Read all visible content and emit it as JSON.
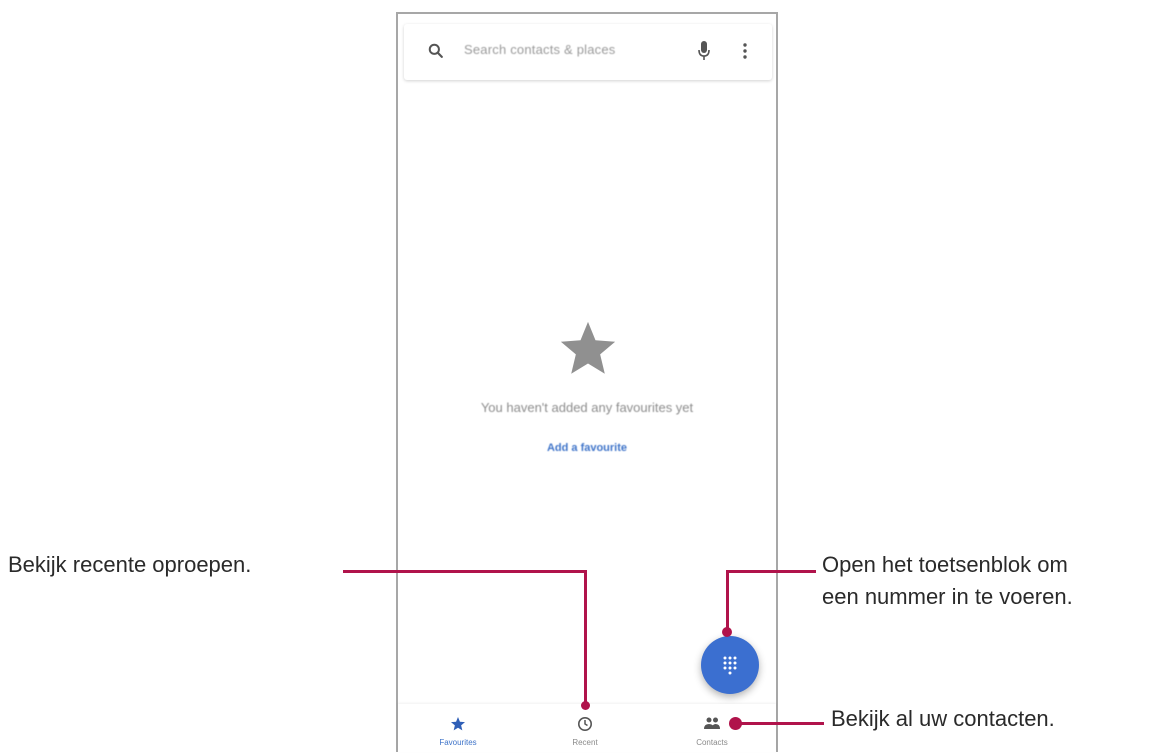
{
  "search": {
    "placeholder": "Search contacts & places"
  },
  "favourites": {
    "empty_message": "You haven't added any favourites yet",
    "add_link": "Add a favourite"
  },
  "bottom_nav": [
    {
      "label": "Favourites",
      "icon": "star-icon",
      "active": true
    },
    {
      "label": "Recent",
      "icon": "clock-icon",
      "active": false
    },
    {
      "label": "Contacts",
      "icon": "people-icon",
      "active": false
    }
  ],
  "fab": {
    "icon": "dialpad-icon"
  },
  "callouts": {
    "recent": "Bekijk recente oproepen.",
    "dialpad_line1": "Open het toetsenblok om",
    "dialpad_line2": "een nummer in te voeren.",
    "contacts": "Bekijk al uw contacten."
  },
  "colors": {
    "accent": "#3b6fd0",
    "callout_line": "#b0134b",
    "star_gray": "#909090"
  }
}
